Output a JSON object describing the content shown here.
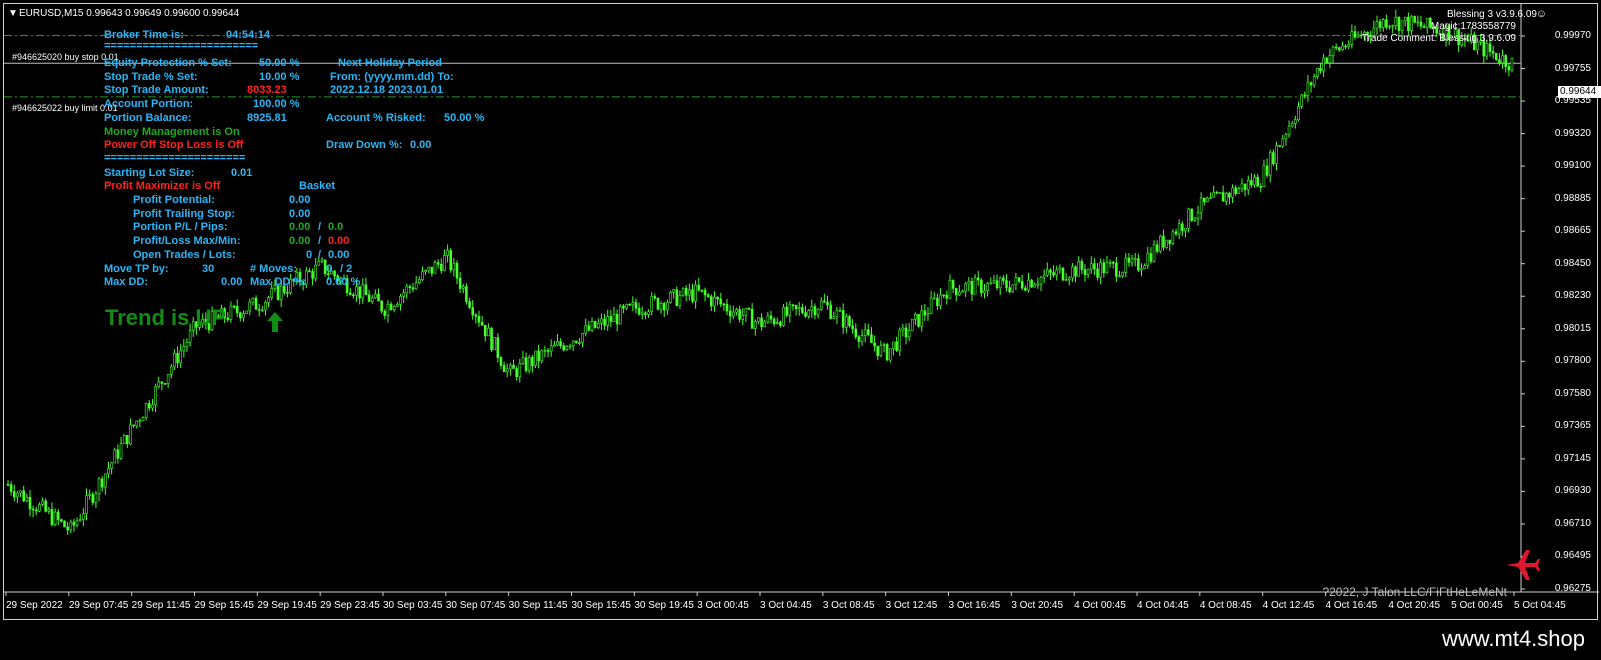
{
  "header": {
    "symbol_line": "EURUSD,M15  0.99643 0.99649 0.99600 0.99644",
    "ea_name": "Blessing 3 v3.9.6.09",
    "magic": "Magic:1783558779",
    "trade_comment": "Trade Comment: Blessing 3.9.6.09"
  },
  "orders": {
    "buy_stop": "#946625020 buy stop 0.01",
    "buy_limit": "#946625022 buy limit 0.01"
  },
  "panel": {
    "broker_time_label": "Broker Time is:",
    "broker_time_value": "04:54:14",
    "separator": "========================",
    "separator2": "======================",
    "equity_protection_label": "Equity Protection % Set:",
    "equity_protection_value": "50.00 %",
    "stop_trade_label": "Stop Trade % Set:",
    "stop_trade_value": "10.00 %",
    "stop_trade_amount_label": "Stop Trade Amount:",
    "stop_trade_amount_value": "8033.23",
    "account_portion_label": "Account Portion:",
    "account_portion_value": "100.00 %",
    "portion_balance_label": "Portion Balance:",
    "portion_balance_value": "8925.81",
    "money_management": "Money Management is On",
    "power_off_stop_loss": "Power Off Stop Loss is Off",
    "holiday_title": "Next Holiday Period",
    "holiday_from": "From: (yyyy.mm.dd) To:",
    "holiday_dates": "2022.12.18  2023.01.01",
    "account_risked_label": "Account % Risked:",
    "account_risked_value": "50.00 %",
    "drawdown_label": "Draw Down %:",
    "drawdown_value": "0.00",
    "starting_lot_label": "Starting Lot Size:",
    "starting_lot_value": "0.01",
    "profit_maximizer": "Profit Maximizer is Off",
    "basket_label": "Basket",
    "profit_potential_label": "Profit Potential:",
    "profit_potential_value": "0.00",
    "profit_trailing_label": "Profit Trailing Stop:",
    "profit_trailing_value": "0.00",
    "portion_pl_label": "Portion P/L / Pips:",
    "portion_pl_value1": "0.00",
    "portion_pl_sep": "/",
    "portion_pl_value2": "0.0",
    "pl_maxmin_label": "Profit/Loss Max/Min:",
    "pl_max_value": "0.00",
    "pl_min_value": "0.00",
    "open_trades_label": "Open Trades / Lots:",
    "open_trades_value": "0",
    "open_lots_value": "0.00",
    "move_tp_label": "Move TP by:",
    "move_tp_value": "30",
    "moves_label": "# Moves:",
    "moves_value": "0",
    "moves_max": "/ 2",
    "max_dd_label": "Max DD:",
    "max_dd_value": "0.00",
    "max_dd_pct_label": "Max DD %:",
    "max_dd_pct_value": "0.00 %",
    "trend": "Trend is UP"
  },
  "price_axis": [
    "0.99970",
    "0.99755",
    "0.99535",
    "0.99320",
    "0.99100",
    "0.98885",
    "0.98665",
    "0.98450",
    "0.98230",
    "0.98015",
    "0.97800",
    "0.97580",
    "0.97365",
    "0.97145",
    "0.96930",
    "0.96710",
    "0.96495",
    "0.96275"
  ],
  "current_price": "0.99644",
  "time_axis": [
    "29 Sep 2022",
    "29 Sep 07:45",
    "29 Sep 11:45",
    "29 Sep 15:45",
    "29 Sep 19:45",
    "29 Sep 23:45",
    "30 Sep 03:45",
    "30 Sep 07:45",
    "30 Sep 11:45",
    "30 Sep 15:45",
    "30 Sep 19:45",
    "3 Oct 00:45",
    "3 Oct 04:45",
    "3 Oct 08:45",
    "3 Oct 12:45",
    "3 Oct 16:45",
    "3 Oct 20:45",
    "4 Oct 00:45",
    "4 Oct 04:45",
    "4 Oct 08:45",
    "4 Oct 12:45",
    "4 Oct 16:45",
    "4 Oct 20:45",
    "5 Oct 00:45",
    "5 Oct 04:45"
  ],
  "copyright": "?2022, J Talon LLC/FiFtHeLeMeNt",
  "website": "www.mt4.shop",
  "colors": {
    "candle": "#44ff2a",
    "order_line": "#1f9a1f",
    "price_line": "#c0c0c0",
    "panel_text": "#29b6f6",
    "warning_text": "#ff2020",
    "trend_text": "#138c13"
  },
  "icons": {
    "trend_arrow": "up-arrow-icon",
    "logo": "airplane-icon",
    "dropdown": "triangle-down-icon"
  },
  "chart_data": {
    "type": "candlestick",
    "symbol": "EURUSD",
    "timeframe": "M15",
    "ylim": [
      0.962,
      1.0003
    ],
    "ohlc_last": {
      "open": 0.99643,
      "high": 0.99649,
      "low": 0.996,
      "close": 0.99644
    },
    "close_path": [
      [
        "29 Sep 2022",
        0.969
      ],
      [
        "29 Sep 07:45",
        0.966
      ],
      [
        "29 Sep 11:45",
        0.9728
      ],
      [
        "29 Sep 15:45",
        0.9793
      ],
      [
        "29 Sep 19:45",
        0.9808
      ],
      [
        "29 Sep 23:45",
        0.9832
      ],
      [
        "30 Sep 03:45",
        0.9805
      ],
      [
        "30 Sep 07:45",
        0.9838
      ],
      [
        "30 Sep 11:45",
        0.9762
      ],
      [
        "30 Sep 15:45",
        0.9785
      ],
      [
        "30 Sep 19:45",
        0.9805
      ],
      [
        "3 Oct 00:45",
        0.9815
      ],
      [
        "3 Oct 04:45",
        0.9795
      ],
      [
        "3 Oct 08:45",
        0.9808
      ],
      [
        "3 Oct 12:45",
        0.9775
      ],
      [
        "3 Oct 16:45",
        0.9818
      ],
      [
        "3 Oct 20:45",
        0.982
      ],
      [
        "4 Oct 00:45",
        0.983
      ],
      [
        "4 Oct 04:45",
        0.9832
      ],
      [
        "4 Oct 08:45",
        0.987
      ],
      [
        "4 Oct 12:45",
        0.989
      ],
      [
        "4 Oct 16:45",
        0.9968
      ],
      [
        "4 Oct 20:45",
        0.9993
      ],
      [
        "5 Oct 00:45",
        0.9985
      ],
      [
        "5 Oct 04:45",
        0.99644
      ]
    ],
    "order_levels": [
      0.99825,
      0.99425
    ]
  }
}
